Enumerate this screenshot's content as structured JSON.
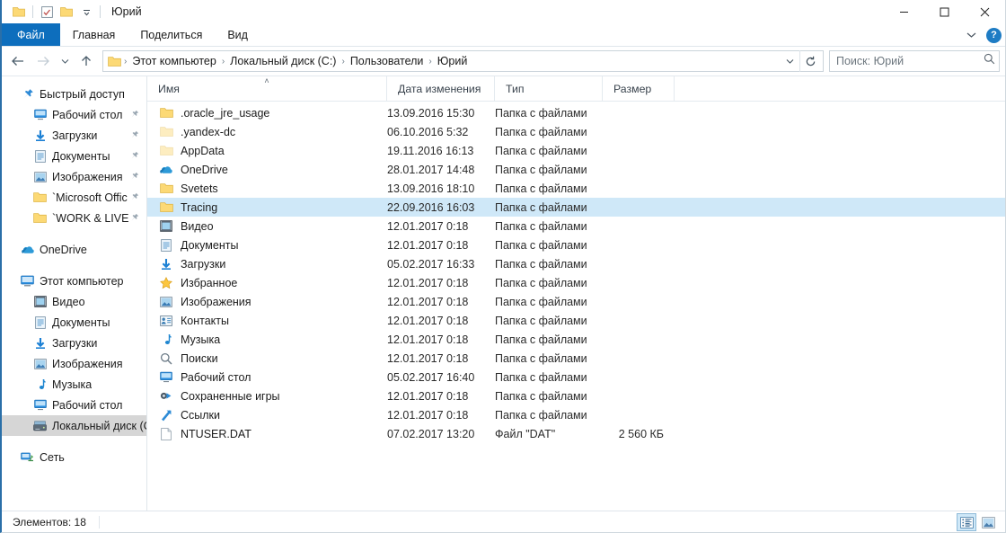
{
  "window": {
    "title": "Юрий",
    "quick_access": [
      {
        "name": "folder-icon",
        "label": "Свойства папки"
      },
      {
        "name": "properties-icon",
        "label": "Свойства"
      },
      {
        "name": "new-folder-icon",
        "label": "Создать папку"
      },
      {
        "name": "chevron-down-icon",
        "label": "Настроить панель быстрого доступа"
      }
    ],
    "controls": {
      "minimize": "─",
      "maximize": "☐",
      "close": "✕"
    }
  },
  "ribbon": {
    "tabs": [
      {
        "label": "Файл",
        "active_file": true
      },
      {
        "label": "Главная",
        "active_file": false
      },
      {
        "label": "Поделиться",
        "active_file": false
      },
      {
        "label": "Вид",
        "active_file": false
      }
    ],
    "collapse_icon": "⌄",
    "help_label": "?"
  },
  "addressbar": {
    "back_icon": "←",
    "forward_icon": "→",
    "recent_icon": "⌄",
    "up_icon": "↑",
    "breadcrumbs": [
      "Этот компьютер",
      "Локальный диск (C:)",
      "Пользователи",
      "Юрий"
    ],
    "separator": "›",
    "dropdown_icon": "⌄",
    "refresh_icon": "↻",
    "search": {
      "placeholder": "Поиск: Юрий",
      "value": "",
      "icon": "⌕"
    }
  },
  "sidebar": {
    "groups": [
      {
        "items": [
          {
            "label": "Быстрый доступ",
            "icon": "pin-icon",
            "level": 0,
            "pinned": false,
            "selected": false
          },
          {
            "label": "Рабочий стол",
            "icon": "desktop-icon",
            "level": 1,
            "pinned": true,
            "selected": false
          },
          {
            "label": "Загрузки",
            "icon": "downloads-icon",
            "level": 1,
            "pinned": true,
            "selected": false
          },
          {
            "label": "Документы",
            "icon": "documents-icon",
            "level": 1,
            "pinned": true,
            "selected": false
          },
          {
            "label": "Изображения",
            "icon": "pictures-icon",
            "level": 1,
            "pinned": true,
            "selected": false
          },
          {
            "label": "`Microsoft Offic",
            "icon": "folder-icon",
            "level": 1,
            "pinned": true,
            "selected": false
          },
          {
            "label": "`WORK & LIVE",
            "icon": "folder-icon",
            "level": 1,
            "pinned": true,
            "selected": false
          }
        ]
      },
      {
        "items": [
          {
            "label": "OneDrive",
            "icon": "onedrive-icon",
            "level": 0,
            "pinned": false,
            "selected": false
          }
        ]
      },
      {
        "items": [
          {
            "label": "Этот компьютер",
            "icon": "computer-icon",
            "level": 0,
            "pinned": false,
            "selected": false
          },
          {
            "label": "Видео",
            "icon": "video-icon",
            "level": 1,
            "pinned": false,
            "selected": false
          },
          {
            "label": "Документы",
            "icon": "documents-icon",
            "level": 1,
            "pinned": false,
            "selected": false
          },
          {
            "label": "Загрузки",
            "icon": "downloads-icon",
            "level": 1,
            "pinned": false,
            "selected": false
          },
          {
            "label": "Изображения",
            "icon": "pictures-icon",
            "level": 1,
            "pinned": false,
            "selected": false
          },
          {
            "label": "Музыка",
            "icon": "music-icon",
            "level": 1,
            "pinned": false,
            "selected": false
          },
          {
            "label": "Рабочий стол",
            "icon": "desktop-icon",
            "level": 1,
            "pinned": false,
            "selected": false
          },
          {
            "label": "Локальный диск (C",
            "icon": "drive-icon",
            "level": 1,
            "pinned": false,
            "selected": true
          }
        ]
      },
      {
        "items": [
          {
            "label": "Сеть",
            "icon": "network-icon",
            "level": 0,
            "pinned": false,
            "selected": false
          }
        ]
      }
    ]
  },
  "filelist": {
    "columns": [
      {
        "label": "Имя",
        "sorted": true,
        "sort_icon": "˄"
      },
      {
        "label": "Дата изменения",
        "sorted": false,
        "sort_icon": ""
      },
      {
        "label": "Тип",
        "sorted": false,
        "sort_icon": ""
      },
      {
        "label": "Размер",
        "sorted": false,
        "sort_icon": ""
      }
    ],
    "rows": [
      {
        "name": ".oracle_jre_usage",
        "date": "13.09.2016 15:30",
        "type": "Папка с файлами",
        "size": "",
        "icon": "folder-icon",
        "dim": false,
        "selected": false
      },
      {
        "name": ".yandex-dc",
        "date": "06.10.2016 5:32",
        "type": "Папка с файлами",
        "size": "",
        "icon": "folder-icon",
        "dim": true,
        "selected": false
      },
      {
        "name": "AppData",
        "date": "19.11.2016 16:13",
        "type": "Папка с файлами",
        "size": "",
        "icon": "folder-icon",
        "dim": true,
        "selected": false
      },
      {
        "name": "OneDrive",
        "date": "28.01.2017 14:48",
        "type": "Папка с файлами",
        "size": "",
        "icon": "onedrive-icon",
        "dim": false,
        "selected": false
      },
      {
        "name": "Svetets",
        "date": "13.09.2016 18:10",
        "type": "Папка с файлами",
        "size": "",
        "icon": "folder-icon",
        "dim": false,
        "selected": false
      },
      {
        "name": "Tracing",
        "date": "22.09.2016 16:03",
        "type": "Папка с файлами",
        "size": "",
        "icon": "folder-icon",
        "dim": false,
        "selected": true
      },
      {
        "name": "Видео",
        "date": "12.01.2017 0:18",
        "type": "Папка с файлами",
        "size": "",
        "icon": "video-icon",
        "dim": false,
        "selected": false
      },
      {
        "name": "Документы",
        "date": "12.01.2017 0:18",
        "type": "Папка с файлами",
        "size": "",
        "icon": "documents-icon",
        "dim": false,
        "selected": false
      },
      {
        "name": "Загрузки",
        "date": "05.02.2017 16:33",
        "type": "Папка с файлами",
        "size": "",
        "icon": "downloads-icon",
        "dim": false,
        "selected": false
      },
      {
        "name": "Избранное",
        "date": "12.01.2017 0:18",
        "type": "Папка с файлами",
        "size": "",
        "icon": "favorites-icon",
        "dim": false,
        "selected": false
      },
      {
        "name": "Изображения",
        "date": "12.01.2017 0:18",
        "type": "Папка с файлами",
        "size": "",
        "icon": "pictures-icon",
        "dim": false,
        "selected": false
      },
      {
        "name": "Контакты",
        "date": "12.01.2017 0:18",
        "type": "Папка с файлами",
        "size": "",
        "icon": "contacts-icon",
        "dim": false,
        "selected": false
      },
      {
        "name": "Музыка",
        "date": "12.01.2017 0:18",
        "type": "Папка с файлами",
        "size": "",
        "icon": "music-icon",
        "dim": false,
        "selected": false
      },
      {
        "name": "Поиски",
        "date": "12.01.2017 0:18",
        "type": "Папка с файлами",
        "size": "",
        "icon": "searches-icon",
        "dim": false,
        "selected": false
      },
      {
        "name": "Рабочий стол",
        "date": "05.02.2017 16:40",
        "type": "Папка с файлами",
        "size": "",
        "icon": "desktop-icon",
        "dim": false,
        "selected": false
      },
      {
        "name": "Сохраненные игры",
        "date": "12.01.2017 0:18",
        "type": "Папка с файлами",
        "size": "",
        "icon": "savedgames-icon",
        "dim": false,
        "selected": false
      },
      {
        "name": "Ссылки",
        "date": "12.01.2017 0:18",
        "type": "Папка с файлами",
        "size": "",
        "icon": "links-icon",
        "dim": false,
        "selected": false
      },
      {
        "name": "NTUSER.DAT",
        "date": "07.02.2017 13:20",
        "type": "Файл \"DAT\"",
        "size": "2 560 КБ",
        "icon": "file-icon",
        "dim": false,
        "selected": false
      }
    ]
  },
  "statusbar": {
    "item_count_text": "Элементов: 18",
    "views": [
      {
        "name": "details-view-button",
        "active": true
      },
      {
        "name": "large-icons-view-button",
        "active": false
      }
    ]
  },
  "colors": {
    "accent": "#0d6ebd",
    "selection": "#cfe8f8",
    "nav_selection": "#d6d6d6",
    "folder": "#ffd municipal"
  }
}
